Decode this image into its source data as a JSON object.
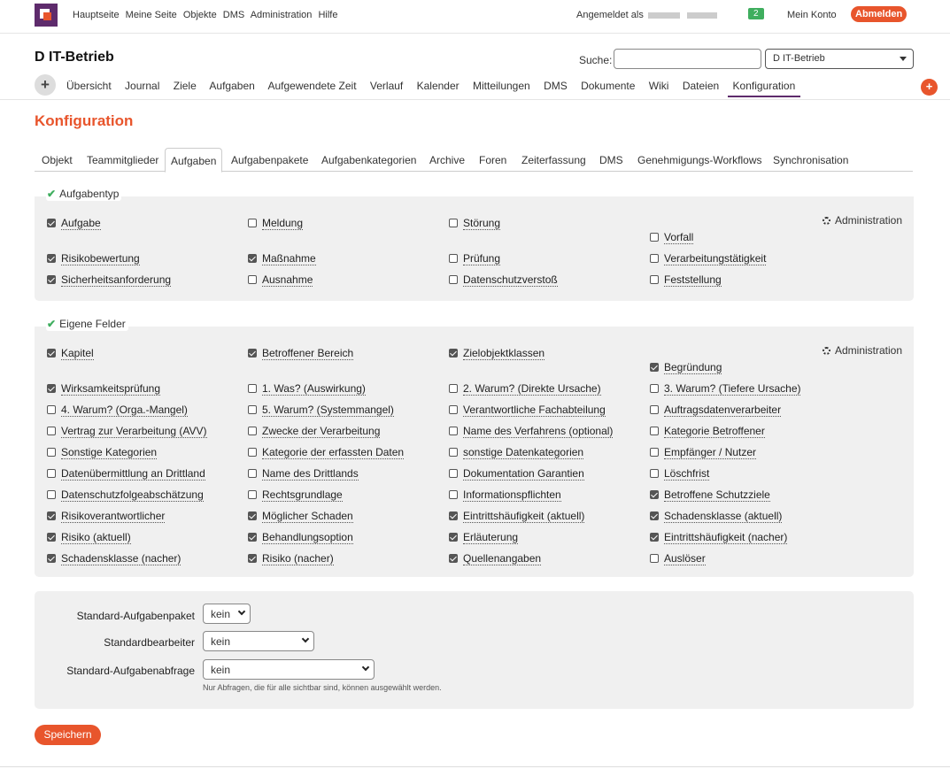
{
  "topbar": {
    "nav": [
      "Hauptseite",
      "Meine Seite",
      "Objekte",
      "DMS",
      "Administration",
      "Hilfe"
    ],
    "login_text": "Angemeldet als",
    "badge": "2",
    "account": "Mein Konto",
    "logout": "Abmelden"
  },
  "project": {
    "title": "D IT-Betrieb",
    "search_label": "Suche:",
    "search_value": "",
    "project_select": "D IT-Betrieb"
  },
  "mainnav": {
    "items": [
      "Übersicht",
      "Journal",
      "Ziele",
      "Aufgaben",
      "Aufgewendete Zeit",
      "Verlauf",
      "Kalender",
      "Mitteilungen",
      "DMS",
      "Dokumente",
      "Wiki",
      "Dateien",
      "Konfiguration"
    ],
    "active": "Konfiguration"
  },
  "page": {
    "heading": "Konfiguration"
  },
  "tabs": [
    "Objekt",
    "Teammitglieder",
    "Aufgaben",
    "Aufgabenpakete",
    "Aufgabenkategorien",
    "Archive",
    "Foren",
    "Zeiterfassung",
    "DMS",
    "Genehmigungs-Workflows",
    "Synchronisation"
  ],
  "active_tab": "Aufgaben",
  "aufgabentyp": {
    "legend": "Aufgabentyp",
    "admin": "Administration",
    "items": [
      {
        "label": "Aufgabe",
        "checked": true
      },
      {
        "label": "Meldung",
        "checked": false
      },
      {
        "label": "Störung",
        "checked": false
      },
      {
        "label": "Vorfall",
        "checked": false
      },
      {
        "label": "Risikobewertung",
        "checked": true
      },
      {
        "label": "Maßnahme",
        "checked": true
      },
      {
        "label": "Prüfung",
        "checked": false
      },
      {
        "label": "Verarbeitungstätigkeit",
        "checked": false
      },
      {
        "label": "Sicherheitsanforderung",
        "checked": true
      },
      {
        "label": "Ausnahme",
        "checked": false
      },
      {
        "label": "Datenschutzverstoß",
        "checked": false
      },
      {
        "label": "Feststellung",
        "checked": false
      }
    ]
  },
  "eigene_felder": {
    "legend": "Eigene Felder",
    "admin": "Administration",
    "items": [
      {
        "label": "Kapitel",
        "checked": true
      },
      {
        "label": "Betroffener Bereich",
        "checked": true
      },
      {
        "label": "Zielobjektklassen",
        "checked": true
      },
      {
        "label": "Begründung",
        "checked": true
      },
      {
        "label": "Wirksamkeitsprüfung",
        "checked": true
      },
      {
        "label": "1. Was? (Auswirkung)",
        "checked": false
      },
      {
        "label": "2. Warum? (Direkte Ursache)",
        "checked": false
      },
      {
        "label": "3. Warum? (Tiefere Ursache)",
        "checked": false
      },
      {
        "label": "4. Warum? (Orga.-Mangel)",
        "checked": false
      },
      {
        "label": "5. Warum? (Systemmangel)",
        "checked": false
      },
      {
        "label": "Verantwortliche Fachabteilung",
        "checked": false
      },
      {
        "label": "Auftragsdatenverarbeiter",
        "checked": false
      },
      {
        "label": "Vertrag zur Verarbeitung (AVV)",
        "checked": false
      },
      {
        "label": "Zwecke der Verarbeitung",
        "checked": false
      },
      {
        "label": "Name des Verfahrens (optional)",
        "checked": false
      },
      {
        "label": "Kategorie Betroffener",
        "checked": false
      },
      {
        "label": "Sonstige Kategorien",
        "checked": false
      },
      {
        "label": "Kategorie der erfassten Daten",
        "checked": false
      },
      {
        "label": "sonstige Datenkategorien",
        "checked": false
      },
      {
        "label": "Empfänger / Nutzer",
        "checked": false
      },
      {
        "label": "Datenübermittlung an Drittland",
        "checked": false
      },
      {
        "label": "Name des Drittlands",
        "checked": false
      },
      {
        "label": "Dokumentation Garantien",
        "checked": false
      },
      {
        "label": "Löschfrist",
        "checked": false
      },
      {
        "label": "Datenschutzfolgeabschätzung",
        "checked": false
      },
      {
        "label": "Rechtsgrundlage",
        "checked": false
      },
      {
        "label": "Informationspflichten",
        "checked": false
      },
      {
        "label": "Betroffene Schutzziele",
        "checked": true
      },
      {
        "label": "Risikoverantwortlicher",
        "checked": true
      },
      {
        "label": "Möglicher Schaden",
        "checked": true
      },
      {
        "label": "Eintrittshäufigkeit (aktuell)",
        "checked": true
      },
      {
        "label": "Schadensklasse (aktuell)",
        "checked": true
      },
      {
        "label": "Risiko (aktuell)",
        "checked": true
      },
      {
        "label": "Behandlungsoption",
        "checked": true
      },
      {
        "label": "Erläuterung",
        "checked": true
      },
      {
        "label": "Eintrittshäufigkeit (nacher)",
        "checked": true
      },
      {
        "label": "Schadensklasse (nacher)",
        "checked": true
      },
      {
        "label": "Risiko (nacher)",
        "checked": true
      },
      {
        "label": "Quellenangaben",
        "checked": true
      },
      {
        "label": "Auslöser",
        "checked": false
      }
    ]
  },
  "defaults": {
    "paket_label": "Standard-Aufgabenpaket",
    "paket_value": "kein",
    "bearbeiter_label": "Standardbearbeiter",
    "bearbeiter_value": "kein",
    "abfrage_label": "Standard-Aufgabenabfrage",
    "abfrage_value": "kein",
    "hint": "Nur Abfragen, die für alle sichtbar sind, können ausgewählt werden."
  },
  "save_label": "Speichern",
  "colors": {
    "accent": "#e8552c",
    "brand": "#5e2b6c",
    "success": "#3fae5e"
  }
}
